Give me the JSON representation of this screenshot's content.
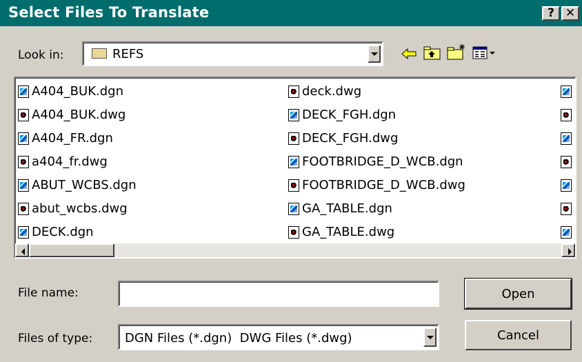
{
  "window": {
    "title": "Select Files To Translate",
    "help_glyph": "?",
    "close_glyph": "✕"
  },
  "lookin": {
    "label": "Look in:",
    "value": "REFS"
  },
  "toolbar": {
    "back_icon": "back-arrow-icon",
    "up_icon": "up-folder-icon",
    "new_icon": "new-folder-icon",
    "view_icon": "view-menu-icon"
  },
  "files": {
    "col1": [
      {
        "name": "A404_BUK.dgn",
        "type": "dgn"
      },
      {
        "name": "A404_BUK.dwg",
        "type": "dwg"
      },
      {
        "name": "A404_FR.dgn",
        "type": "dgn"
      },
      {
        "name": "a404_fr.dwg",
        "type": "dwg"
      },
      {
        "name": "ABUT_WCBS.dgn",
        "type": "dgn"
      },
      {
        "name": "abut_wcbs.dwg",
        "type": "dwg"
      },
      {
        "name": "DECK.dgn",
        "type": "dgn"
      }
    ],
    "col2": [
      {
        "name": "deck.dwg",
        "type": "dwg"
      },
      {
        "name": "DECK_FGH.dgn",
        "type": "dgn"
      },
      {
        "name": "DECK_FGH.dwg",
        "type": "dwg"
      },
      {
        "name": "FOOTBRIDGE_D_WCB.dgn",
        "type": "dgn"
      },
      {
        "name": "FOOTBRIDGE_D_WCB.dwg",
        "type": "dwg"
      },
      {
        "name": "GA_TABLE.dgn",
        "type": "dgn"
      },
      {
        "name": "GA_TABLE.dwg",
        "type": "dwg"
      }
    ]
  },
  "filename": {
    "label": "File name:",
    "value": ""
  },
  "filetype": {
    "label": "Files of type:",
    "value": "DGN Files (*.dgn)  DWG Files (*.dwg)"
  },
  "buttons": {
    "open": "Open",
    "cancel": "Cancel"
  }
}
